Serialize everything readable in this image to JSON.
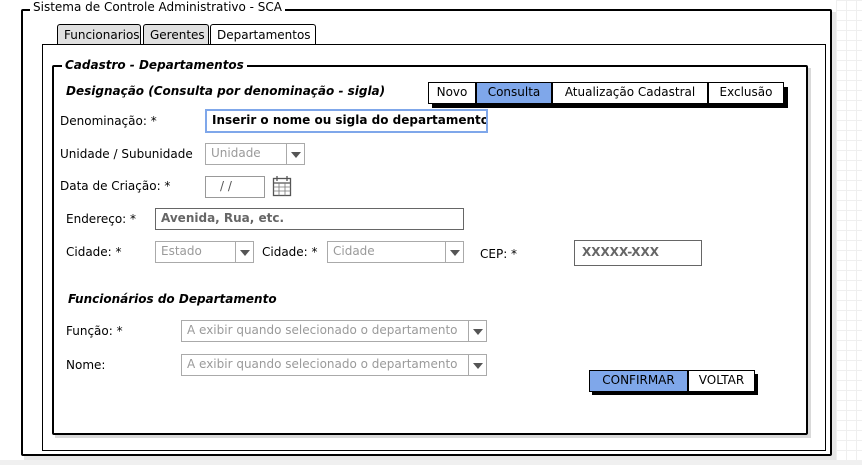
{
  "window": {
    "title": "Sistema de Controle Administrativo - SCA"
  },
  "tabs": [
    {
      "label": "Funcionarios"
    },
    {
      "label": "Gerentes"
    },
    {
      "label": "Departamentos"
    }
  ],
  "panel": {
    "title": "Cadastro - Departamentos",
    "section_title": "Designação (Consulta por denominação - sigla)",
    "modes": [
      "Novo",
      "Consulta",
      "Atualização Cadastral",
      "Exclusão"
    ],
    "selected_mode": "Consulta"
  },
  "form": {
    "denominacao_label": "Denominação: *",
    "denominacao_value": "Inserir o nome ou sigla do departamento",
    "unidade_label": "Unidade / Subunidade",
    "unidade_value": "Unidade",
    "data_label": "Data de Criação: *",
    "data_value": "/ /",
    "endereco_label": "Endereço: *",
    "endereco_value": "Avenida, Rua, etc.",
    "estado_label": "Cidade: *",
    "estado_value": "Estado",
    "cidade_label": "Cidade: *",
    "cidade_value": "Cidade",
    "cep_label": "CEP: *",
    "cep_value": "XXXXX-XXX"
  },
  "funcionarios": {
    "title": "Funcionários do Departamento",
    "funcao_label": "Função: *",
    "funcao_value": "A exibir quando selecionado o departamento",
    "nome_label": "Nome:",
    "nome_value": "A exibir quando selecionado o departamento"
  },
  "actions": {
    "confirm_label": "CONFIRMAR",
    "back_label": "VOLTAR"
  },
  "colors": {
    "accent": "#7fa7ea",
    "border": "#000000"
  }
}
